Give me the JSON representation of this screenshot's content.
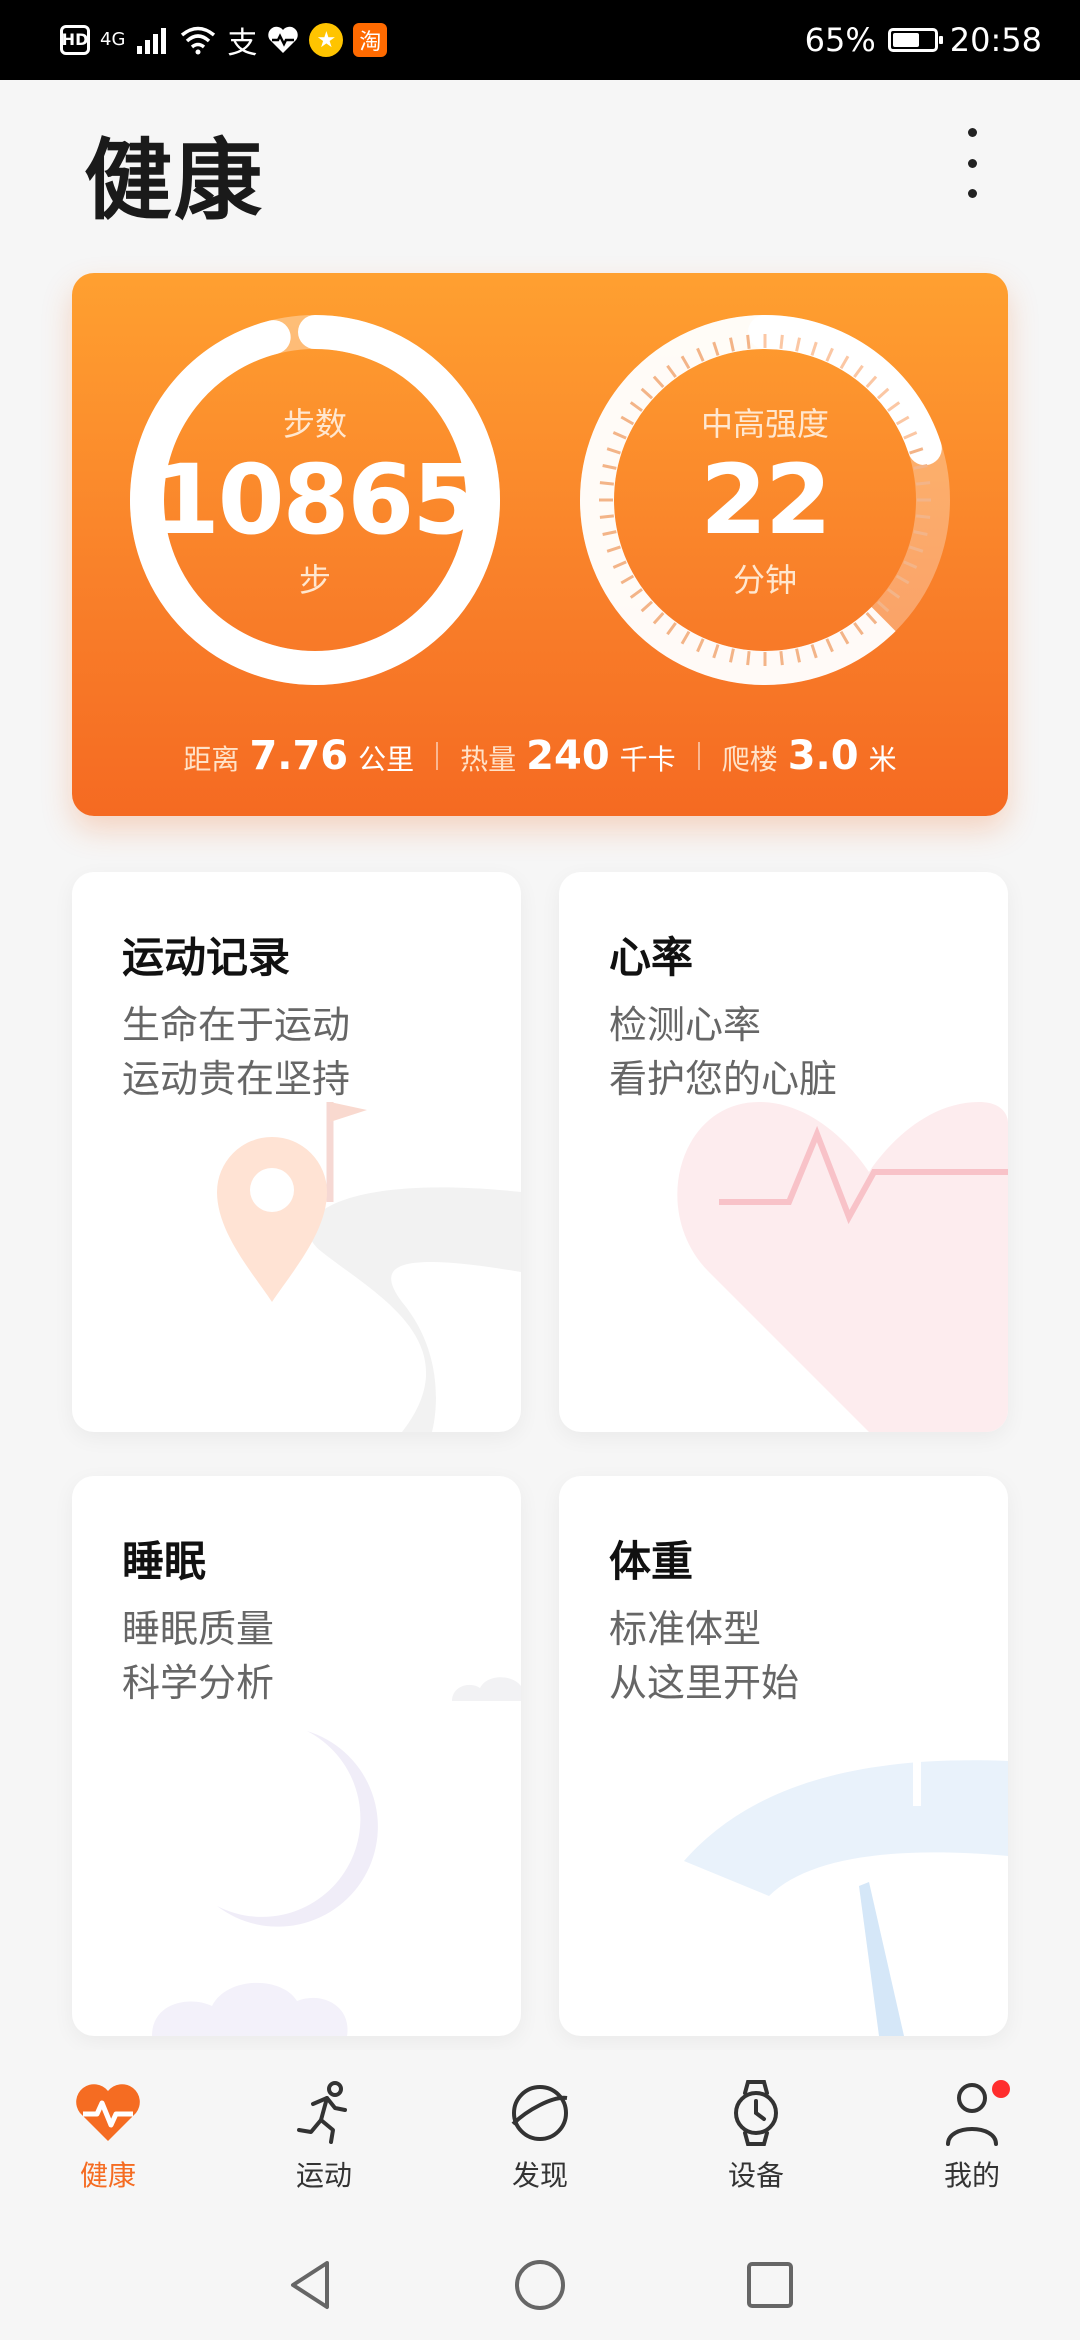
{
  "status_bar": {
    "hd": "HD",
    "network": "4G",
    "alipay_glyph": "支",
    "taobao_glyph": "淘",
    "battery_percent": "65%",
    "battery_level": 0.65,
    "time": "20:58",
    "icons": [
      "hd-icon",
      "signal-icon",
      "wifi-icon",
      "alipay-icon",
      "health-heart-icon",
      "star-app-icon",
      "taobao-icon",
      "battery-icon"
    ]
  },
  "page": {
    "title": "健康"
  },
  "summary": {
    "steps": {
      "label": "步数",
      "value": "10865",
      "unit": "步",
      "progress": 0.96
    },
    "intensity": {
      "label": "中高强度",
      "value": "22",
      "unit": "分钟",
      "progress": 0.2
    },
    "distance": {
      "label": "距离",
      "value": "7.76",
      "unit": "公里"
    },
    "calories": {
      "label": "热量",
      "value": "240",
      "unit": "千卡"
    },
    "climb": {
      "label": "爬楼",
      "value": "3.0",
      "unit": "米"
    },
    "colors": {
      "card_top": "#ffa030",
      "card_bottom": "#f56a22"
    }
  },
  "cards": [
    {
      "title": "运动记录",
      "line1": "生命在于运动",
      "line2": "运动贵在坚持"
    },
    {
      "title": "心率",
      "line1": "检测心率",
      "line2": "看护您的心脏"
    },
    {
      "title": "睡眠",
      "line1": "睡眠质量",
      "line2": "科学分析"
    },
    {
      "title": "体重",
      "line1": "标准体型",
      "line2": "从这里开始"
    }
  ],
  "bottom_nav": [
    {
      "label": "健康",
      "icon": "health-heart-icon",
      "active": true
    },
    {
      "label": "运动",
      "icon": "running-icon"
    },
    {
      "label": "发现",
      "icon": "discover-planet-icon"
    },
    {
      "label": "设备",
      "icon": "watch-icon"
    },
    {
      "label": "我的",
      "icon": "profile-icon",
      "badge": true
    }
  ],
  "accent_color": "#f56c22"
}
